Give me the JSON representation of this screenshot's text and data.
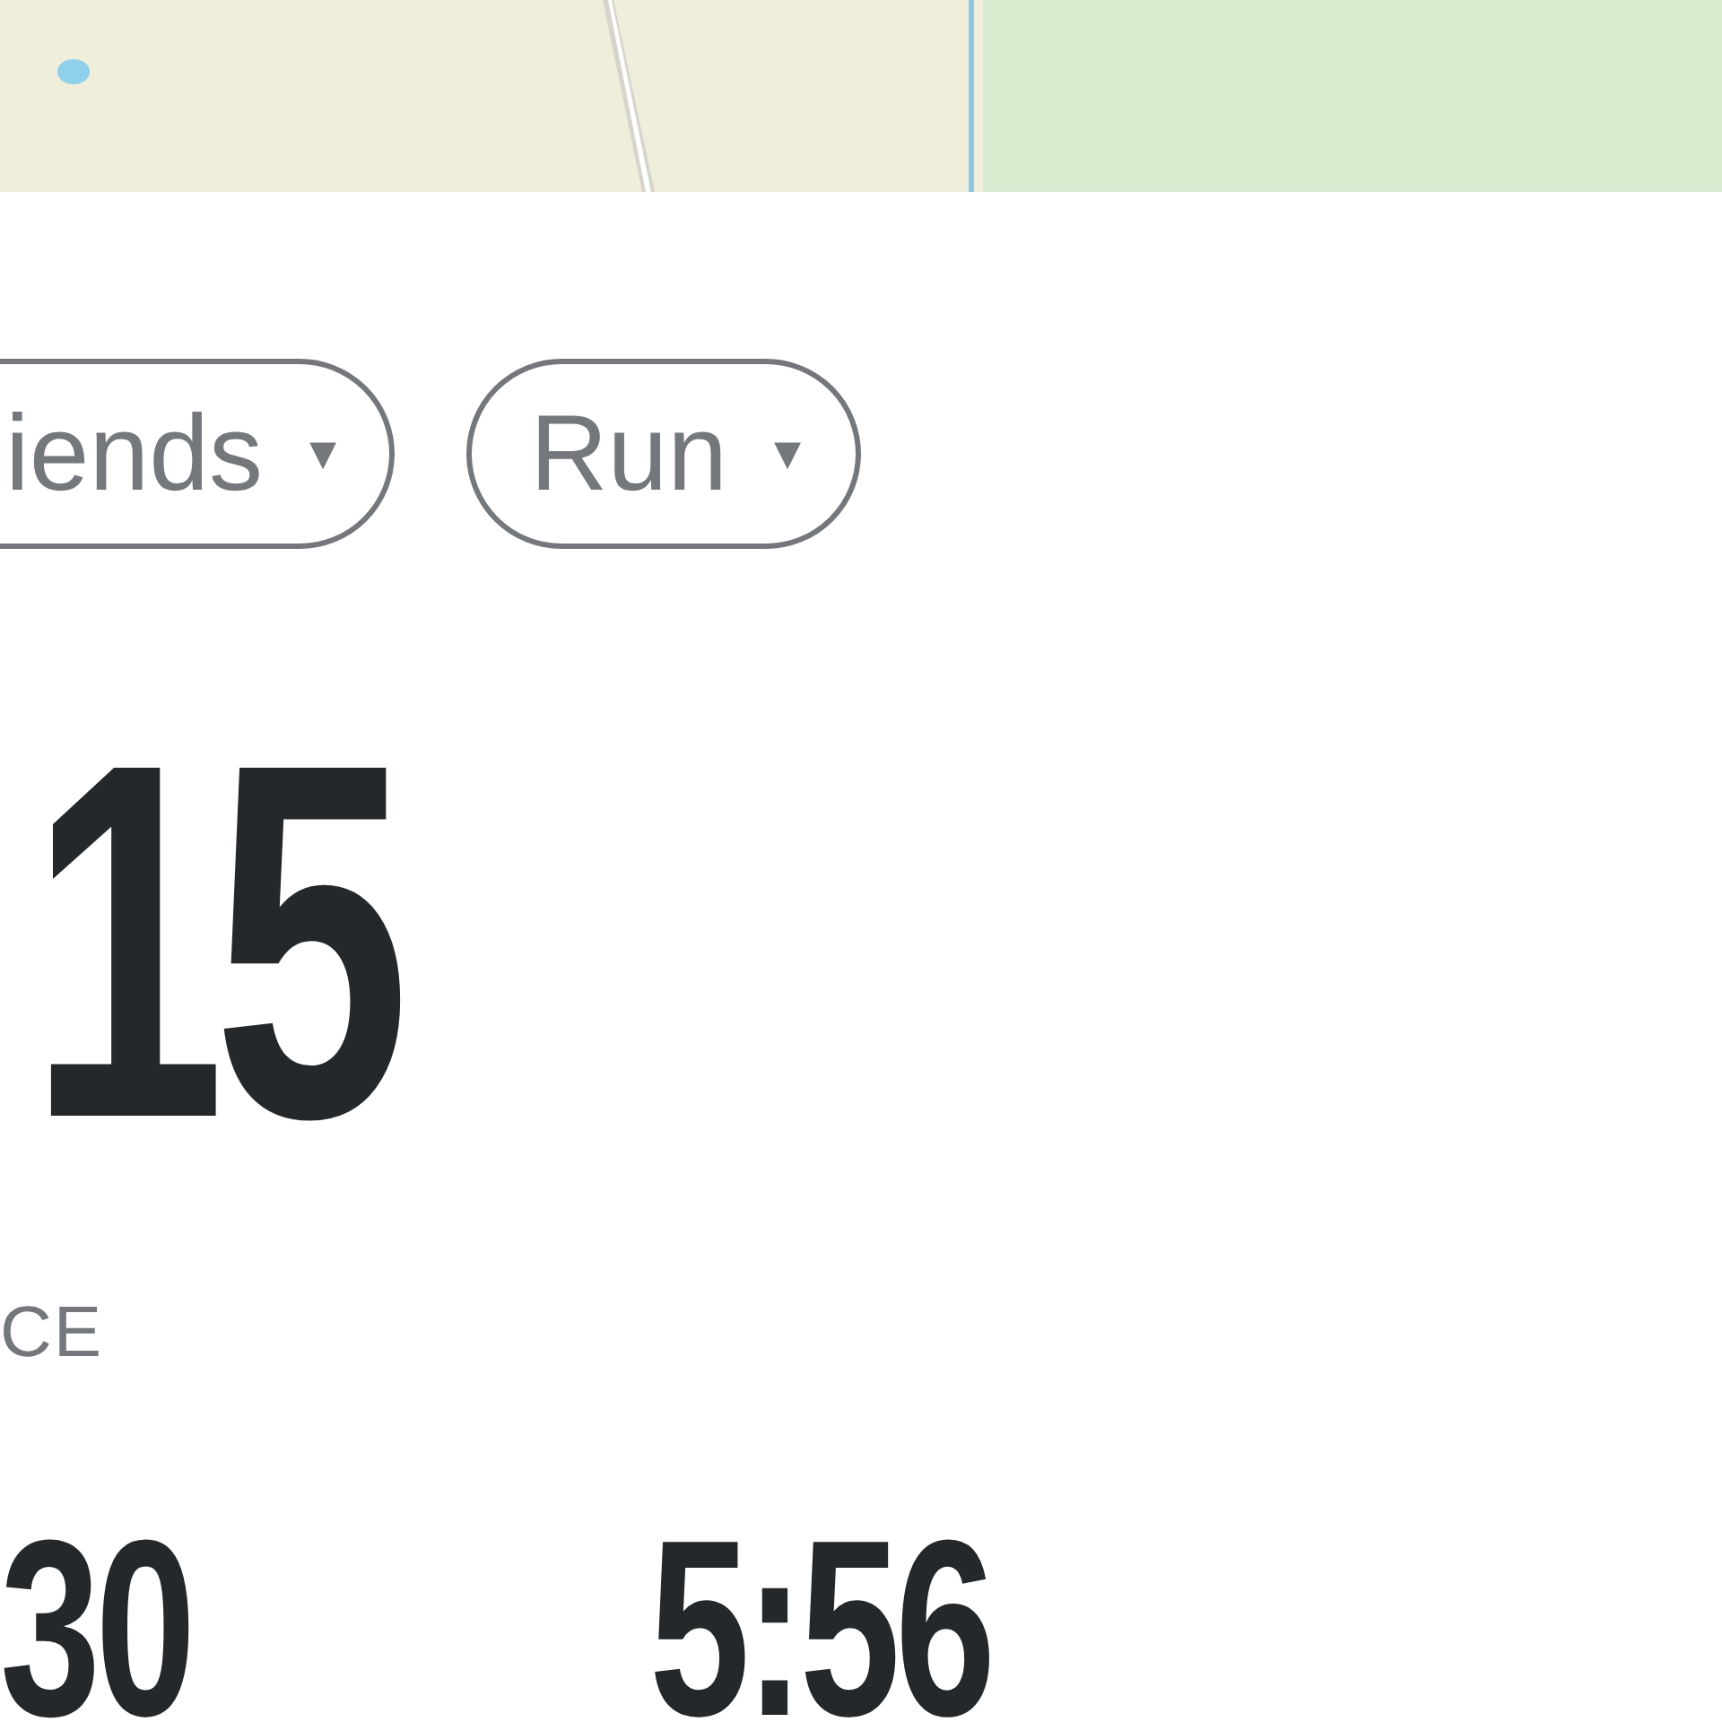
{
  "filters": [
    {
      "label": "iends",
      "caret": "▾"
    },
    {
      "label": "Run",
      "caret": "▾"
    }
  ],
  "distance": {
    "value": "15",
    "label": "CE"
  },
  "stats": [
    {
      "value": "30"
    },
    {
      "value": "5:56"
    }
  ]
}
